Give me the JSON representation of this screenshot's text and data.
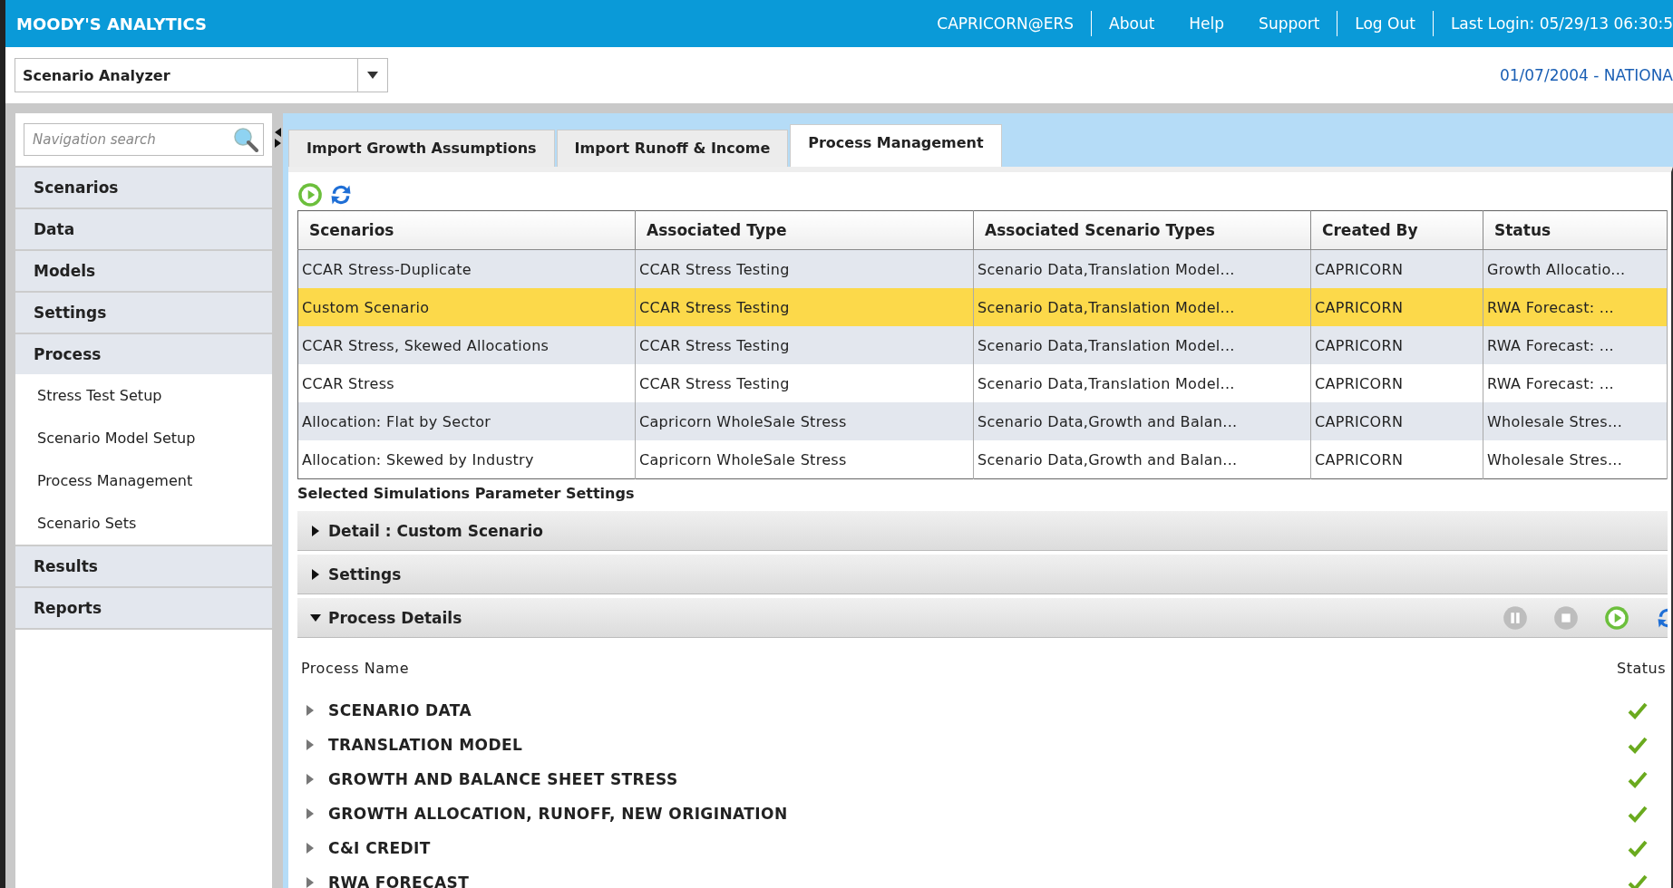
{
  "header": {
    "brand": "MOODY'S ANALYTICS",
    "user": "CAPRICORN@ERS",
    "links": [
      "About",
      "Help",
      "Support"
    ],
    "logout": "Log Out",
    "last_login": "Last Login: 05/29/13 06:30:5"
  },
  "app_selector": {
    "value": "Scenario Analyzer"
  },
  "as_of": "01/07/2004 - NATIONA",
  "sidebar": {
    "search": {
      "placeholder": "Navigation search"
    },
    "items": [
      {
        "label": "Scenarios"
      },
      {
        "label": "Data"
      },
      {
        "label": "Models"
      },
      {
        "label": "Settings"
      },
      {
        "label": "Process",
        "expanded": true,
        "children": [
          {
            "label": "Stress Test Setup"
          },
          {
            "label": "Scenario Model Setup"
          },
          {
            "label": "Process Management"
          },
          {
            "label": "Scenario Sets"
          }
        ]
      },
      {
        "label": "Results"
      },
      {
        "label": "Reports"
      }
    ]
  },
  "tabs": [
    {
      "label": "Import Growth Assumptions",
      "selected": false
    },
    {
      "label": "Import Runoff & Income",
      "selected": false
    },
    {
      "label": "Process Management",
      "selected": true
    }
  ],
  "table": {
    "columns": [
      "Scenarios",
      "Associated Type",
      "Associated Scenario Types",
      "Created By",
      "Status"
    ],
    "rows": [
      {
        "cells": [
          "CCAR Stress-Duplicate",
          "CCAR Stress Testing",
          "Scenario Data,Translation Model...",
          "CAPRICORN",
          "Growth Allocatio..."
        ],
        "selected": false
      },
      {
        "cells": [
          "Custom Scenario",
          "CCAR Stress Testing",
          "Scenario Data,Translation Model...",
          "CAPRICORN",
          "RWA Forecast: ..."
        ],
        "selected": true
      },
      {
        "cells": [
          "CCAR Stress, Skewed Allocations",
          "CCAR Stress Testing",
          "Scenario Data,Translation Model...",
          "CAPRICORN",
          "RWA Forecast: ..."
        ],
        "selected": false
      },
      {
        "cells": [
          "CCAR Stress",
          "CCAR Stress Testing",
          "Scenario Data,Translation Model...",
          "CAPRICORN",
          "RWA Forecast: ..."
        ],
        "selected": false
      },
      {
        "cells": [
          "Allocation: Flat by Sector",
          "Capricorn WholeSale Stress",
          "Scenario Data,Growth and Balan...",
          "CAPRICORN",
          "Wholesale Stres..."
        ],
        "selected": false
      },
      {
        "cells": [
          "Allocation: Skewed by Industry",
          "Capricorn WholeSale Stress",
          "Scenario Data,Growth and Balan...",
          "CAPRICORN",
          "Wholesale Stres..."
        ],
        "selected": false
      }
    ]
  },
  "parameters_title": "Selected Simulations Parameter Settings",
  "sections": [
    {
      "title": "Detail : Custom Scenario",
      "expanded": false
    },
    {
      "title": "Settings",
      "expanded": false
    },
    {
      "title": "Process Details",
      "expanded": true
    }
  ],
  "process": {
    "columns": [
      "Process Name",
      "Status"
    ],
    "rows": [
      {
        "name": "SCENARIO DATA",
        "complete": true
      },
      {
        "name": "TRANSLATION MODEL",
        "complete": true
      },
      {
        "name": "GROWTH AND BALANCE SHEET STRESS",
        "complete": true
      },
      {
        "name": "GROWTH ALLOCATION, RUNOFF, NEW ORIGINATION",
        "complete": true
      },
      {
        "name": "C&I CREDIT",
        "complete": true
      },
      {
        "name": "RWA FORECAST",
        "complete": true
      }
    ]
  }
}
